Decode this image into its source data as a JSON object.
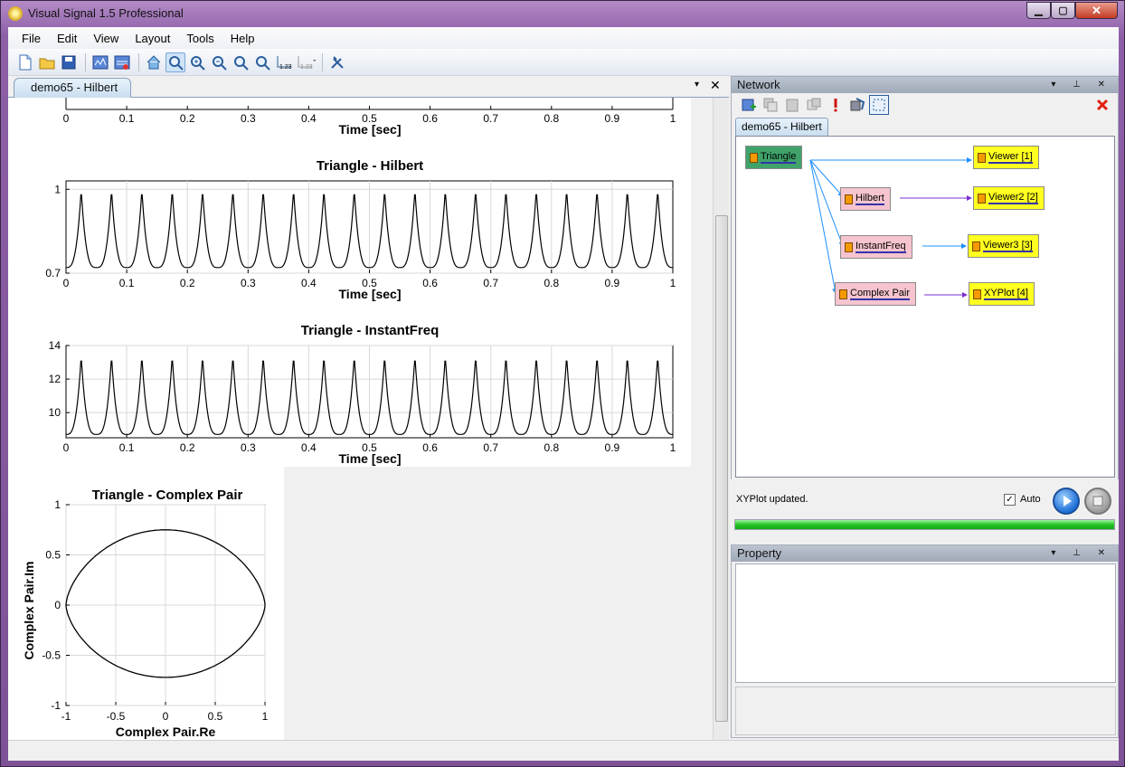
{
  "window": {
    "title": "Visual Signal 1.5 Professional",
    "min": "0",
    "max": "1",
    "close": "r"
  },
  "menu": [
    "File",
    "Edit",
    "View",
    "Layout",
    "Tools",
    "Help"
  ],
  "toolbar_icons": [
    "new-icon",
    "open-icon",
    "save-icon",
    "config-icon",
    "config2-icon",
    "home-icon",
    "zoom-fit-icon",
    "zoom-in-icon",
    "zoom-out-icon",
    "zoom-x-icon",
    "zoom-y-icon",
    "value-icon",
    "value-dropdown-icon",
    "settings-icon"
  ],
  "doc_tab": {
    "label": "demo65 - Hilbert",
    "menu": "▾",
    "close": "✕"
  },
  "plots": {
    "top_xlabel": "Time [sec]",
    "hilbert": {
      "title": "Triangle - Hilbert",
      "xlabel": "Time [sec]"
    },
    "instfreq": {
      "title": "Triangle - InstantFreq",
      "xlabel": "Time [sec]"
    },
    "complex": {
      "title": "Triangle - Complex Pair",
      "xlabel": "Complex Pair.Re",
      "ylabel": "Complex Pair.Im"
    }
  },
  "chart_data": [
    {
      "type": "line",
      "title": "",
      "xlabel": "Time [sec]",
      "xlim": [
        0,
        1
      ],
      "xticks": [
        "0",
        "0.1",
        "0.2",
        "0.3",
        "0.4",
        "0.5",
        "0.6",
        "0.7",
        "0.8",
        "0.9",
        "1"
      ],
      "note": "partially scrolled out of view; only x axis visible"
    },
    {
      "type": "line",
      "title": "Triangle - Hilbert",
      "xlabel": "Time [sec]",
      "xlim": [
        0,
        1
      ],
      "ylim": [
        0.7,
        1.03
      ],
      "yticks": [
        "0.7",
        "1"
      ],
      "xticks": [
        "0",
        "0.1",
        "0.2",
        "0.3",
        "0.4",
        "0.5",
        "0.6",
        "0.7",
        "0.8",
        "0.9",
        "1"
      ],
      "series": [
        {
          "period": 0.05,
          "peak": 1.0,
          "trough": 0.72,
          "phase": 0.025
        }
      ]
    },
    {
      "type": "line",
      "title": "Triangle - InstantFreq",
      "xlabel": "Time [sec]",
      "xlim": [
        0,
        1
      ],
      "ylim": [
        8.5,
        14
      ],
      "yticks": [
        "10",
        "12",
        "14"
      ],
      "xticks": [
        "0",
        "0.1",
        "0.2",
        "0.3",
        "0.4",
        "0.5",
        "0.6",
        "0.7",
        "0.8",
        "0.9",
        "1"
      ],
      "series": [
        {
          "period": 0.05,
          "peak": 13.4,
          "trough": 8.7,
          "phase": 0.025
        }
      ]
    },
    {
      "type": "scatter",
      "title": "Triangle - Complex Pair",
      "xlabel": "Complex Pair.Re",
      "ylabel": "Complex Pair.Im",
      "xlim": [
        -1,
        1
      ],
      "ylim": [
        -1,
        1
      ],
      "xticks": [
        "-1",
        "-0.5",
        "0",
        "0.5",
        "1"
      ],
      "yticks": [
        "-1",
        "-0.5",
        "0",
        "0.5",
        "1"
      ],
      "series": [
        {
          "shape": "closed lens curve",
          "x_range": [
            -1,
            1
          ],
          "y_max": 0.75,
          "y_min": -0.72
        }
      ]
    }
  ],
  "network": {
    "title": "Network",
    "tab": "demo65 - Hilbert",
    "nodes": [
      {
        "id": "triangle",
        "label": "Triangle",
        "kind": "src"
      },
      {
        "id": "hilbert",
        "label": "Hilbert",
        "kind": "proc"
      },
      {
        "id": "instfreq",
        "label": "InstantFreq",
        "kind": "proc"
      },
      {
        "id": "complexpair",
        "label": "Complex Pair",
        "kind": "proc"
      },
      {
        "id": "viewer1",
        "label": "Viewer [1]",
        "kind": "view"
      },
      {
        "id": "viewer2",
        "label": "Viewer2 [2]",
        "kind": "view"
      },
      {
        "id": "viewer3",
        "label": "Viewer3 [3]",
        "kind": "view"
      },
      {
        "id": "xyplot",
        "label": "XYPlot [4]",
        "kind": "view"
      }
    ],
    "edge_colors": {
      "source": "#1e90ff",
      "processed": "#7b2fd0"
    }
  },
  "control": {
    "status": "XYPlot updated.",
    "auto_label": "Auto",
    "auto_checked": "✓",
    "progress": 1.0
  },
  "property": {
    "title": "Property"
  },
  "panel_buttons": "▾ ⊥ ✕"
}
